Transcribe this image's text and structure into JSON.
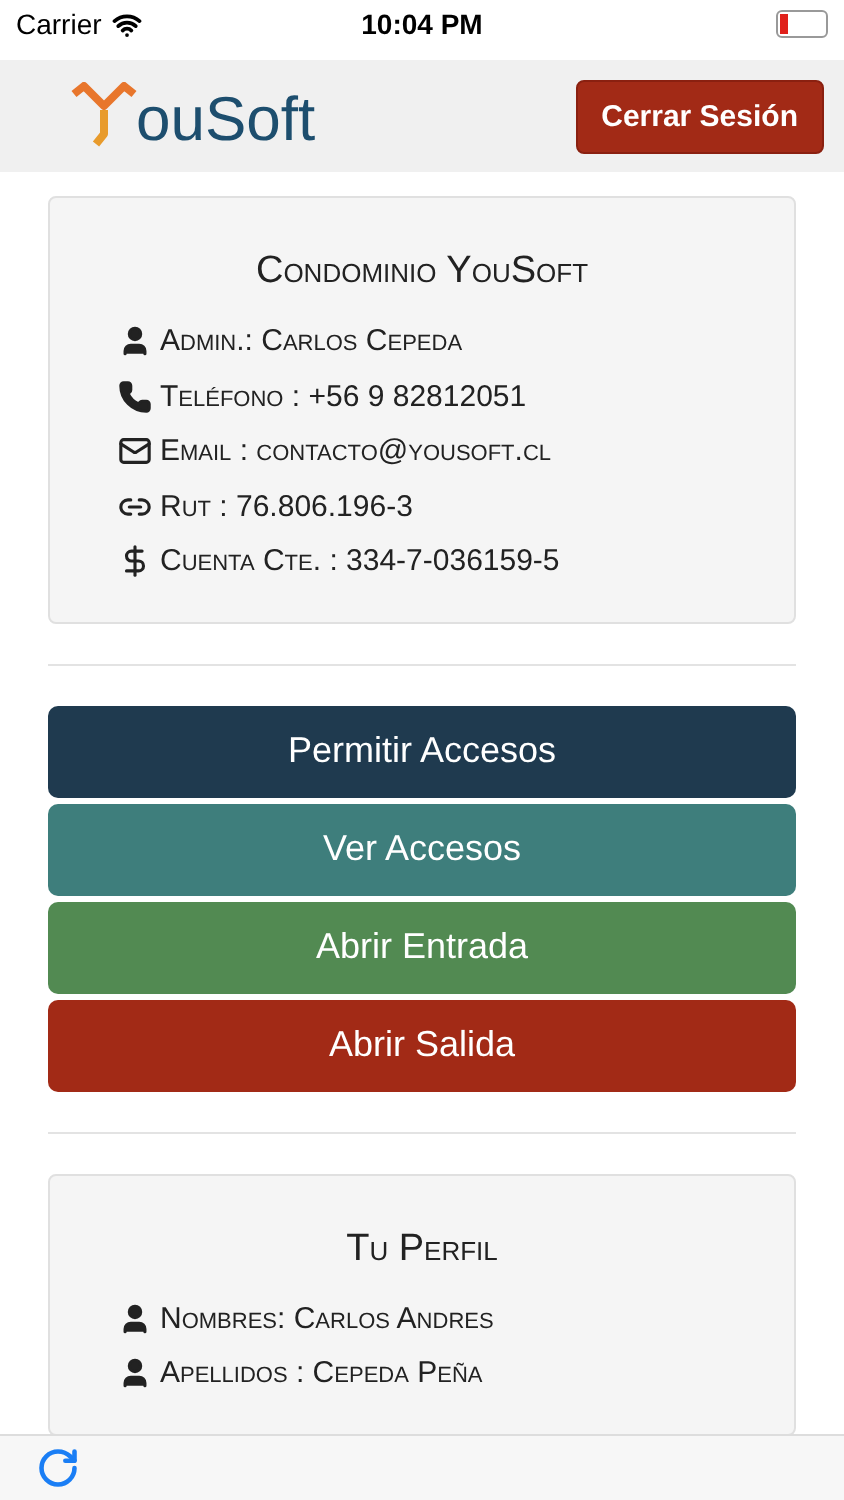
{
  "status_bar": {
    "carrier": "Carrier",
    "time": "10:04 PM"
  },
  "header": {
    "logo_text": "ouSoft",
    "logout_button": "Cerrar Sesión"
  },
  "condo_card": {
    "title": "Condominio YouSoft",
    "rows": [
      {
        "kind": "user",
        "text": "Admin.: Carlos Cepeda"
      },
      {
        "kind": "phone",
        "text": "Teléfono : +56 9 82812051"
      },
      {
        "kind": "mail",
        "text": "Email : contacto@yousoft.cl"
      },
      {
        "kind": "link",
        "text": "Rut : 76.806.196-3"
      },
      {
        "kind": "dollar",
        "text": "Cuenta Cte. : 334-7-036159-5"
      }
    ]
  },
  "actions": [
    {
      "label": "Permitir Accesos",
      "color": "#1f3a4f"
    },
    {
      "label": "Ver Accesos",
      "color": "#3e7e7c"
    },
    {
      "label": "Abrir Entrada",
      "color": "#528a52"
    },
    {
      "label": "Abrir Salida",
      "color": "#a22a16"
    }
  ],
  "profile_card": {
    "title": "Tu Perfil",
    "rows": [
      {
        "kind": "user",
        "text": "Nombres: Carlos Andres"
      },
      {
        "kind": "user",
        "text": "Apellidos : Cepeda Peña"
      }
    ]
  }
}
